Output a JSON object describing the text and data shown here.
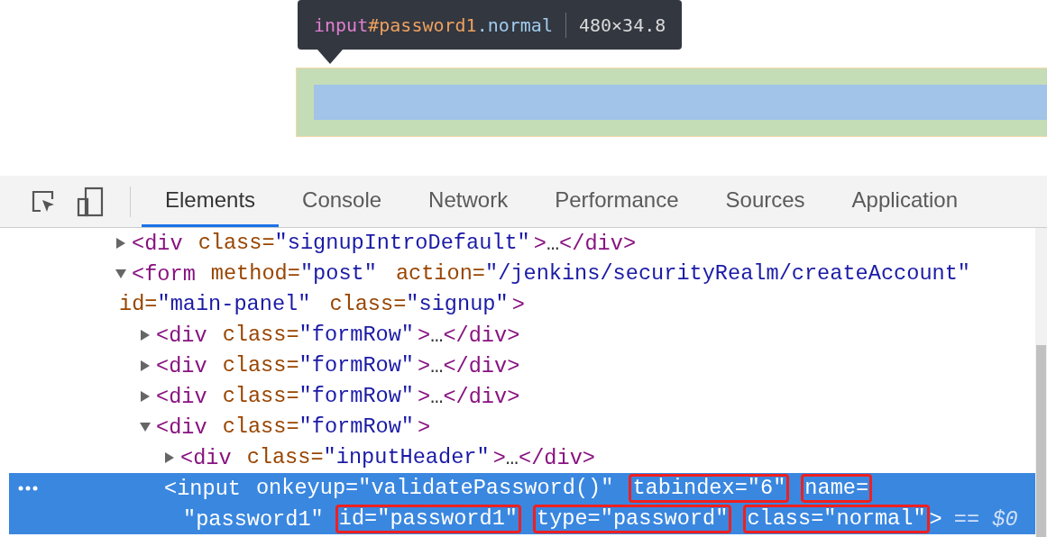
{
  "tooltip": {
    "tag": "input",
    "id": "#password1",
    "class": ".normal",
    "size": "480×34.8"
  },
  "devtools": {
    "tabs": [
      {
        "label": "Elements",
        "selected": true
      },
      {
        "label": "Console",
        "selected": false
      },
      {
        "label": "Network",
        "selected": false
      },
      {
        "label": "Performance",
        "selected": false
      },
      {
        "label": "Sources",
        "selected": false
      },
      {
        "label": "Application",
        "selected": false
      }
    ],
    "tree": [
      {
        "expanded": false,
        "selected": false,
        "lines": [
          [
            {
              "kind": "tag",
              "text": "<div"
            },
            {
              "kind": "attr",
              "name": "class=",
              "value": "\"signupIntroDefault\""
            },
            {
              "kind": "tag",
              "text": ">"
            },
            {
              "kind": "ellipsis",
              "text": "…"
            },
            {
              "kind": "tag",
              "text": "</div>"
            }
          ]
        ]
      },
      {
        "expanded": true,
        "selected": false,
        "lines": [
          [
            {
              "kind": "tag",
              "text": "<form"
            },
            {
              "kind": "attr",
              "name": "method=",
              "value": "\"post\""
            },
            {
              "kind": "attr",
              "name": "action=",
              "value": "\"/jenkins/securityRealm/createAccount\""
            }
          ],
          [
            {
              "kind": "attr",
              "name": "id=",
              "value": "\"main-panel\""
            },
            {
              "kind": "attr",
              "name": "class=",
              "value": "\"signup\""
            },
            {
              "kind": "tag",
              "text": ">"
            }
          ]
        ],
        "children": [
          {
            "expanded": false,
            "selected": false,
            "lines": [
              [
                {
                  "kind": "tag",
                  "text": "<div"
                },
                {
                  "kind": "attr",
                  "name": "class=",
                  "value": "\"formRow\""
                },
                {
                  "kind": "tag",
                  "text": ">"
                },
                {
                  "kind": "ellipsis",
                  "text": "…"
                },
                {
                  "kind": "tag",
                  "text": "</div>"
                }
              ]
            ]
          },
          {
            "expanded": false,
            "selected": false,
            "lines": [
              [
                {
                  "kind": "tag",
                  "text": "<div"
                },
                {
                  "kind": "attr",
                  "name": "class=",
                  "value": "\"formRow\""
                },
                {
                  "kind": "tag",
                  "text": ">"
                },
                {
                  "kind": "ellipsis",
                  "text": "…"
                },
                {
                  "kind": "tag",
                  "text": "</div>"
                }
              ]
            ]
          },
          {
            "expanded": false,
            "selected": false,
            "lines": [
              [
                {
                  "kind": "tag",
                  "text": "<div"
                },
                {
                  "kind": "attr",
                  "name": "class=",
                  "value": "\"formRow\""
                },
                {
                  "kind": "tag",
                  "text": ">"
                },
                {
                  "kind": "ellipsis",
                  "text": "…"
                },
                {
                  "kind": "tag",
                  "text": "</div>"
                }
              ]
            ]
          },
          {
            "expanded": true,
            "selected": false,
            "lines": [
              [
                {
                  "kind": "tag",
                  "text": "<div"
                },
                {
                  "kind": "attr",
                  "name": "class=",
                  "value": "\"formRow\""
                },
                {
                  "kind": "tag",
                  "text": ">"
                }
              ]
            ],
            "children": [
              {
                "expanded": false,
                "selected": false,
                "lines": [
                  [
                    {
                      "kind": "tag",
                      "text": "<div"
                    },
                    {
                      "kind": "attr",
                      "name": "class=",
                      "value": "\"inputHeader\""
                    },
                    {
                      "kind": "tag",
                      "text": ">"
                    },
                    {
                      "kind": "ellipsis",
                      "text": "…"
                    },
                    {
                      "kind": "tag",
                      "text": "</div>"
                    }
                  ]
                ]
              },
              {
                "selected": true,
                "lines": [
                  [
                    {
                      "kind": "tag",
                      "text": "<input"
                    },
                    {
                      "kind": "attr",
                      "name": "onkeyup=",
                      "value": "\"validatePassword()\"",
                      "boxed": false
                    },
                    {
                      "kind": "attr",
                      "name": "tabindex=",
                      "value": "\"6\"",
                      "boxed": true
                    },
                    {
                      "kind": "attr",
                      "name": "name=",
                      "boxed": true
                    }
                  ],
                  [
                    {
                      "kind": "value",
                      "text": "\"password1\""
                    },
                    {
                      "kind": "attr",
                      "name": "id=",
                      "value": "\"password1\"",
                      "boxed": true
                    },
                    {
                      "kind": "attr",
                      "name": "type=",
                      "value": "\"password\"",
                      "boxed": true
                    },
                    {
                      "kind": "attr",
                      "name": "class=",
                      "value": "\"normal\"",
                      "boxed": true
                    },
                    {
                      "kind": "tag",
                      "text": ">"
                    },
                    {
                      "kind": "suffix",
                      "text": "== $0"
                    }
                  ]
                ]
              }
            ]
          }
        ]
      }
    ]
  }
}
